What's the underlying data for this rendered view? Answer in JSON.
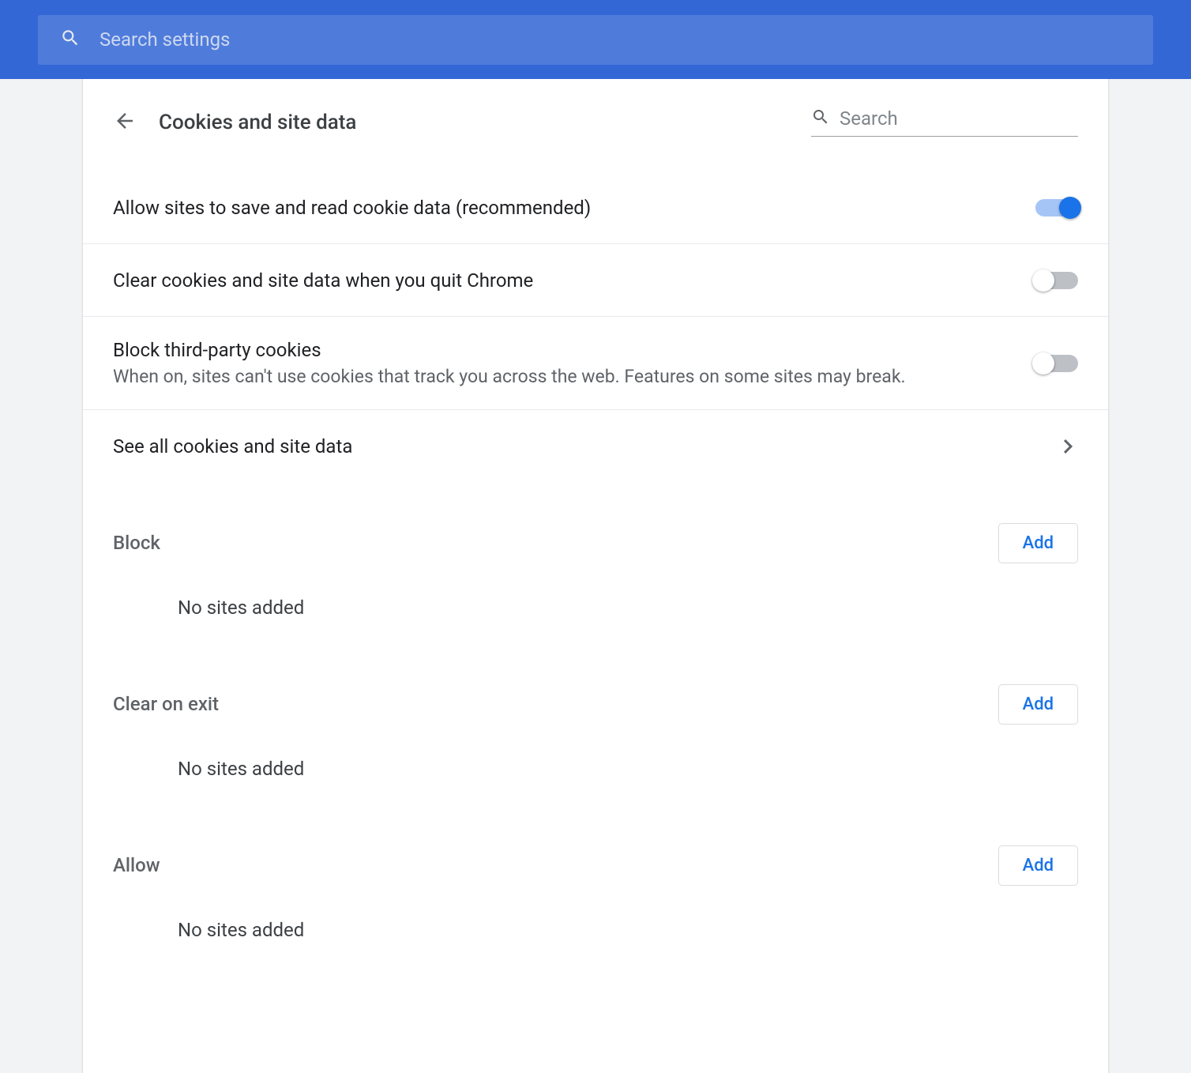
{
  "topbar": {
    "search_placeholder": "Search settings"
  },
  "header": {
    "title": "Cookies and site data",
    "search_placeholder": "Search"
  },
  "rows": {
    "allow_cookies": {
      "title": "Allow sites to save and read cookie data (recommended)",
      "enabled": true
    },
    "clear_on_quit": {
      "title": "Clear cookies and site data when you quit Chrome",
      "enabled": false
    },
    "block_third_party": {
      "title": "Block third-party cookies",
      "subtitle": "When on, sites can't use cookies that track you across the web. Features on some sites may break.",
      "enabled": false
    },
    "see_all": {
      "title": "See all cookies and site data"
    }
  },
  "sections": {
    "block": {
      "title": "Block",
      "add_label": "Add",
      "empty": "No sites added"
    },
    "clear_on_exit": {
      "title": "Clear on exit",
      "add_label": "Add",
      "empty": "No sites added"
    },
    "allow": {
      "title": "Allow",
      "add_label": "Add",
      "empty": "No sites added"
    }
  }
}
